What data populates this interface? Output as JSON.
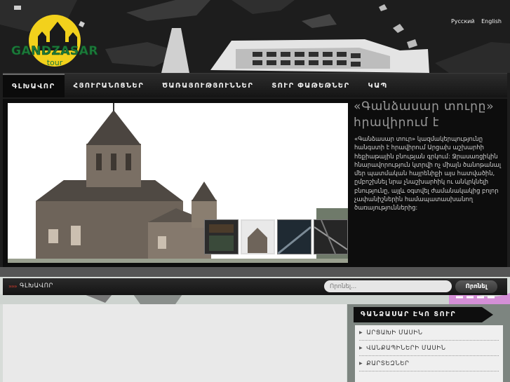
{
  "brand": {
    "name": "GANDZASAR",
    "sub": "tour"
  },
  "languages": [
    "Русский",
    "English"
  ],
  "nav": {
    "items": [
      {
        "label": "ԳԼԽԱՎՈՐ",
        "active": true
      },
      {
        "label": "ՀՅՈՒՐԱՆՈՑՆԵՐ"
      },
      {
        "label": "ԾԱՌԱՅՈՒԹՅՈՒՆՆԵՐ"
      },
      {
        "label": "ՏՈՒՐ ՓԱԹԵԹՆԵՐ"
      },
      {
        "label": "ԿԱՊ"
      }
    ]
  },
  "feature": {
    "title": "«Գանձասար տուրը» հրավիրում է",
    "text": "«Գանձասար տուր» կազմակերպությունը հանգստի է հրավիրում Արցախ աշխարհի հեքիաթային բնության գրկում: Ջրասառցիկին հնարավորություն կտրվի ոչ միայն ծանոթանալ մեր պատմական հայրենիքի այս հատվածին, ըմբոշխնել նրա չնաշխարհիկ ու անկրկնելի բնությունը, այլև օգտվել ժամանակակից բոլոր չափանիշներին համապատասխանող ծառայություններից:",
    "thumbnails": 4,
    "selected_thumbnail": 2
  },
  "breadcrumb": {
    "arrow": "»»»",
    "current": "ԳԼԽԱՎՈՐ"
  },
  "search": {
    "placeholder": "Որոնել...",
    "button": "Որոնել"
  },
  "sidebar": {
    "heading": "ԳԱՆՁԱՍԱՐ ԷԿՈ ՏՈՒՐ",
    "items": [
      "ԱՐՑԱԽԻ ՄԱՍԻՆ",
      "ՎԱՆՔԱՊԻՆԵՐԻ ՄԱՍԻՆ",
      "ՔԱՐՏԵԶՆԵՐ"
    ]
  },
  "colors": {
    "accent": "#c0392b",
    "logo_green": "#1c7a3a",
    "logo_yellow": "#f2d11c"
  }
}
